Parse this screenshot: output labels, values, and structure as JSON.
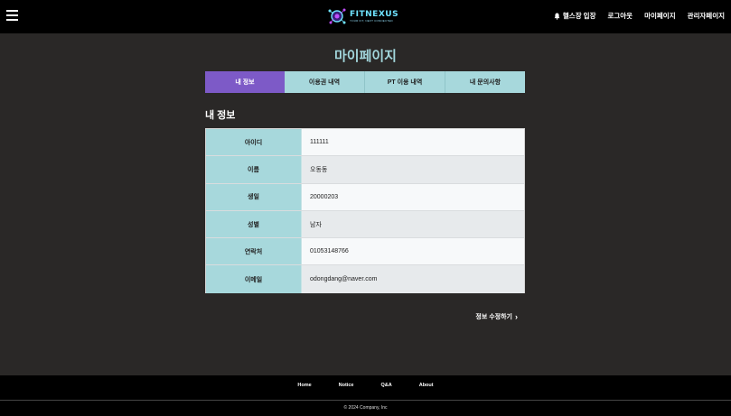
{
  "header": {
    "logo_name": "FITNEXUS",
    "logo_tagline": "YOUR FIT, NEXT CONNECTED",
    "nav": [
      "헬스장 입장",
      "로그아웃",
      "마이페이지",
      "관리자페이지"
    ]
  },
  "page": {
    "title": "마이페이지",
    "tabs": [
      "내 정보",
      "이용권 내역",
      "PT 이용 내역",
      "내 문의사항"
    ],
    "active_tab": "내 정보",
    "section_title": "내 정보"
  },
  "profile": {
    "rows": [
      {
        "label": "아이디",
        "value": "111111"
      },
      {
        "label": "이름",
        "value": "오동동"
      },
      {
        "label": "생일",
        "value": "20000203"
      },
      {
        "label": "성별",
        "value": "남자"
      },
      {
        "label": "연락처",
        "value": "01053148766"
      },
      {
        "label": "이메일",
        "value": "odongdang@naver.com"
      }
    ],
    "edit_label": "정보 수정하기"
  },
  "footer": {
    "nav": [
      "Home",
      "Notice",
      "Q&A",
      "About"
    ],
    "copyright": "© 2024 Company, Inc"
  },
  "colors": {
    "accent": "#7d5ac7",
    "tab_bg": "#a7d8dc",
    "title": "#a2d6dc",
    "background": "#2a2827"
  },
  "icons": [
    "menu-icon",
    "bell-icon",
    "chevron-right-icon"
  ]
}
